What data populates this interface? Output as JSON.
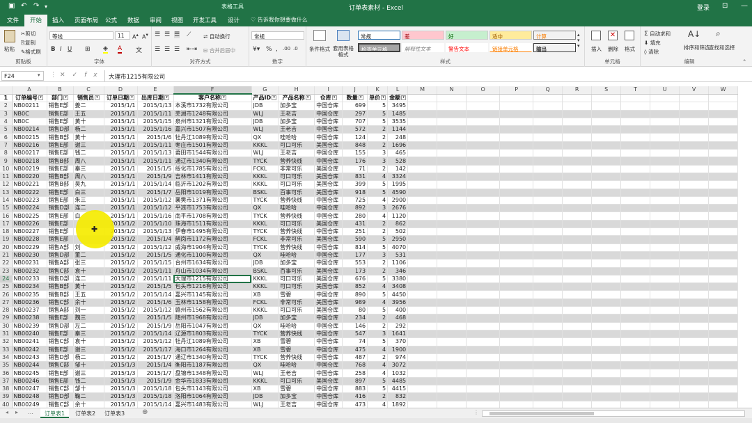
{
  "window": {
    "title": "订单表素材 - Excel",
    "tools_label": "表格工具",
    "login": "登录"
  },
  "tabs": [
    "文件",
    "开始",
    "插入",
    "页面布局",
    "公式",
    "数据",
    "审阅",
    "视图",
    "开发工具",
    "设计"
  ],
  "tell_me": "告诉我你想要做什么",
  "ribbon": {
    "clipboard": {
      "paste": "粘贴",
      "cut": "剪切",
      "copy": "复制",
      "painter": "格式刷",
      "label": "剪贴板"
    },
    "font": {
      "name": "等线",
      "size": "11",
      "label": "字体"
    },
    "alignment": {
      "wrap": "自动换行",
      "merge": "合并后居中",
      "label": "对齐方式"
    },
    "number": {
      "format": "常规",
      "label": "数字"
    },
    "styles": {
      "cond": "条件格式",
      "table": "套用表格格式",
      "cells": [
        "常规",
        "差",
        "好",
        "适中",
        "计算",
        "检查单元格",
        "解释性文本",
        "警告文本",
        "链接单元格",
        "输出"
      ],
      "label": "样式"
    },
    "cells": {
      "insert": "插入",
      "delete": "删除",
      "format": "格式",
      "label": "单元格"
    },
    "editing": {
      "autosum": "自动求和",
      "fill": "填充",
      "clear": "清除",
      "sort": "排序和筛选",
      "find": "查找和选择",
      "label": "编辑"
    }
  },
  "formula": {
    "name_box": "F24",
    "content": "大理市1215有限公司"
  },
  "columns": [
    "A",
    "B",
    "C",
    "D",
    "E",
    "F",
    "G",
    "H",
    "I",
    "J",
    "K",
    "L",
    "M",
    "N",
    "O",
    "P",
    "Q",
    "R",
    "S",
    "T",
    "U",
    "V",
    "W"
  ],
  "headers": [
    "订单编号",
    "部门",
    "销售员",
    "订单日期",
    "出库日期",
    "客户名称",
    "产品ID",
    "产品名称",
    "仓库",
    "数量",
    "单价",
    "金额"
  ],
  "rows": [
    [
      "NB00211",
      "销售E部",
      "姜二",
      "2015/1/1",
      "2015/1/13",
      "本溪市1732有限公司",
      "JDB",
      "加多宝",
      "中国仓库",
      "699",
      "5",
      "3495"
    ],
    [
      "NB0C",
      "销售E部",
      "王五",
      "2015/1/1",
      "2015/1/11",
      "芜湖市1248有限公司",
      "WLJ",
      "王老吉",
      "中国仓库",
      "297",
      "5",
      "1485"
    ],
    [
      "NB0C",
      "销售E部",
      "黄十",
      "2015/1/1",
      "2015/1/15",
      "泉州市1321有限公司",
      "JDB",
      "加多宝",
      "中国仓库",
      "707",
      "5",
      "3535"
    ],
    [
      "NB00214",
      "销售D部",
      "杨二",
      "2015/1/1",
      "2015/1/16",
      "嘉兴市1507有限公司",
      "WLJ",
      "王老吉",
      "中国仓库",
      "572",
      "2",
      "1144"
    ],
    [
      "NB00215",
      "销售B部",
      "黄十",
      "2015/1/1",
      "2015/1/6",
      "牡丹江1089有限公司",
      "QX",
      "哇哈哈",
      "中国仓库",
      "124",
      "2",
      "248"
    ],
    [
      "NB00216",
      "销售E部",
      "谢三",
      "2015/1/1",
      "2015/1/11",
      "枣庄市1501有限公司",
      "KKKL",
      "可口可乐",
      "美国仓库",
      "848",
      "2",
      "1696"
    ],
    [
      "NB00217",
      "销售E部",
      "钱二",
      "2015/1/1",
      "2015/1/13",
      "莆田市1544有限公司",
      "WLJ",
      "王老吉",
      "中国仓库",
      "155",
      "3",
      "465"
    ],
    [
      "NB00218",
      "销售B部",
      "周八",
      "2015/1/1",
      "2015/1/11",
      "通辽市1340有限公司",
      "TYCK",
      "营养快线",
      "中国仓库",
      "176",
      "3",
      "528"
    ],
    [
      "NB00219",
      "销售E部",
      "秦三",
      "2015/1/1",
      "2015/1/5",
      "绥化市1785有限公司",
      "FCKL",
      "非常可乐",
      "美国仓库",
      "71",
      "2",
      "142"
    ],
    [
      "NB00220",
      "销售B部",
      "周八",
      "2015/1/1",
      "2015/1/9",
      "吉林市1411有限公司",
      "KKKL",
      "可口可乐",
      "美国仓库",
      "831",
      "4",
      "3324"
    ],
    [
      "NB00221",
      "销售B部",
      "吴九",
      "2015/1/1",
      "2015/1/14",
      "临沂市1202有限公司",
      "KKKL",
      "可口可乐",
      "美国仓库",
      "399",
      "5",
      "1995"
    ],
    [
      "NB00222",
      "销售E部",
      "白三",
      "2015/1/1",
      "2015/1/7",
      "岳阳市1019有限公司",
      "BSKL",
      "百事可乐",
      "美国仓库",
      "918",
      "5",
      "4590"
    ],
    [
      "NB00223",
      "销售E部",
      "朱三",
      "2015/1/1",
      "2015/1/12",
      "襄樊市1371有限公司",
      "TYCK",
      "营养快线",
      "中国仓库",
      "725",
      "4",
      "2900"
    ],
    [
      "NB00224",
      "销售D部",
      "连二",
      "2015/1/1",
      "2015/1/12",
      "平凉市1753有限公司",
      "QX",
      "哇哈哈",
      "中国仓库",
      "892",
      "3",
      "2676"
    ],
    [
      "NB00225",
      "销售E部",
      "白",
      "2015/1/1",
      "2015/1/16",
      "南平市1708有限公司",
      "TYCK",
      "营养快线",
      "中国仓库",
      "280",
      "4",
      "1120"
    ],
    [
      "NB00226",
      "销售E部",
      "",
      "2015/1/2",
      "2015/1/10",
      "珠海市1511有限公司",
      "KKKL",
      "可口可乐",
      "美国仓库",
      "431",
      "2",
      "862"
    ],
    [
      "NB00227",
      "销售E部",
      "",
      "2015/1/2",
      "2015/1/13",
      "伊春市1495有限公司",
      "TYCK",
      "营养快线",
      "中国仓库",
      "251",
      "2",
      "502"
    ],
    [
      "NB00228",
      "销售E部",
      "",
      "2015/1/2",
      "2015/1/4",
      "鹤岗市1172有限公司",
      "FCKL",
      "非常可乐",
      "美国仓库",
      "590",
      "5",
      "2950"
    ],
    [
      "NB00229",
      "销售A部",
      "刘",
      "2015/1/2",
      "2015/1/12",
      "威海市1904有限公司",
      "TYCK",
      "营养快线",
      "中国仓库",
      "814",
      "5",
      "4070"
    ],
    [
      "NB00230",
      "销售D部",
      "董二",
      "2015/1/2",
      "2015/1/5",
      "通化市1100有限公司",
      "QX",
      "哇哈哈",
      "中国仓库",
      "177",
      "3",
      "531"
    ],
    [
      "NB00231",
      "销售A部",
      "张三",
      "2015/1/2",
      "2015/1/15",
      "台州市1634有限公司",
      "JDB",
      "加多宝",
      "中国仓库",
      "553",
      "2",
      "1106"
    ],
    [
      "NB00232",
      "销售C部",
      "袁十",
      "2015/1/2",
      "2015/1/11",
      "舟山市1034有限公司",
      "BSKL",
      "百事可乐",
      "美国仓库",
      "173",
      "2",
      "346"
    ],
    [
      "NB00233",
      "销售D部",
      "连二",
      "2015/1/2",
      "2015/1/11",
      "大理市1215有限公司",
      "KKKL",
      "可口可乐",
      "美国仓库",
      "676",
      "5",
      "3380"
    ],
    [
      "NB00234",
      "销售B部",
      "黄十",
      "2015/1/2",
      "2015/1/5",
      "包头市1216有限公司",
      "KKKL",
      "可口可乐",
      "美国仓库",
      "852",
      "4",
      "3408"
    ],
    [
      "NB00235",
      "销售B部",
      "王五",
      "2015/1/2",
      "2015/1/14",
      "嘉兴市1145有限公司",
      "XB",
      "雪碧",
      "中国仓库",
      "890",
      "5",
      "4450"
    ],
    [
      "NB00236",
      "销售C部",
      "余十",
      "2015/1/2",
      "2015/1/6",
      "玉林市1158有限公司",
      "FCKL",
      "非常可乐",
      "美国仓库",
      "989",
      "4",
      "3956"
    ],
    [
      "NB00237",
      "销售A部",
      "刘一",
      "2015/1/2",
      "2015/1/12",
      "赣州市1562有限公司",
      "KKKL",
      "可口可乐",
      "美国仓库",
      "80",
      "5",
      "400"
    ],
    [
      "NB00238",
      "销售E部",
      "魏三",
      "2015/1/2",
      "2015/1/5",
      "随州市1968有限公司",
      "JDB",
      "加多宝",
      "中国仓库",
      "234",
      "2",
      "468"
    ],
    [
      "NB00239",
      "销售D部",
      "左二",
      "2015/1/2",
      "2015/1/9",
      "岳阳市1047有限公司",
      "QX",
      "哇哈哈",
      "中国仓库",
      "146",
      "2",
      "292"
    ],
    [
      "NB00240",
      "销售E部",
      "秦三",
      "2015/1/2",
      "2015/1/14",
      "辽源市1803有限公司",
      "TYCK",
      "营养快线",
      "中国仓库",
      "547",
      "3",
      "1641"
    ],
    [
      "NB00241",
      "销售C部",
      "袁十",
      "2015/1/2",
      "2015/1/12",
      "牡丹江1089有限公司",
      "XB",
      "雪碧",
      "中国仓库",
      "74",
      "5",
      "370"
    ],
    [
      "NB00242",
      "销售E部",
      "谢三",
      "2015/1/2",
      "2015/1/17",
      "海口市1264有限公司",
      "XB",
      "雪碧",
      "中国仓库",
      "475",
      "4",
      "1900"
    ],
    [
      "NB00243",
      "销售D部",
      "杨二",
      "2015/1/2",
      "2015/1/7",
      "通辽市1340有限公司",
      "TYCK",
      "营养快线",
      "中国仓库",
      "487",
      "2",
      "974"
    ],
    [
      "NB00244",
      "销售C部",
      "邹十",
      "2015/1/3",
      "2015/1/4",
      "衡阳市1187有限公司",
      "QX",
      "哇哈哈",
      "中国仓库",
      "768",
      "4",
      "3072"
    ],
    [
      "NB00245",
      "销售E部",
      "谢三",
      "2015/1/3",
      "2015/1/7",
      "盘锦市1348有限公司",
      "WLJ",
      "王老吉",
      "中国仓库",
      "258",
      "4",
      "1032"
    ],
    [
      "NB00246",
      "销售E部",
      "钱二",
      "2015/1/3",
      "2015/1/9",
      "金华市1833有限公司",
      "KKKL",
      "可口可乐",
      "美国仓库",
      "897",
      "5",
      "4485"
    ],
    [
      "NB00247",
      "销售C部",
      "邹十",
      "2015/1/3",
      "2015/1/18",
      "包头市1143有限公司",
      "XB",
      "雪碧",
      "中国仓库",
      "883",
      "5",
      "4415"
    ],
    [
      "NB00248",
      "销售D部",
      "鞠二",
      "2015/1/3",
      "2015/1/18",
      "洛阳市1064有限公司",
      "JDB",
      "加多宝",
      "中国仓库",
      "416",
      "2",
      "832"
    ],
    [
      "NB00249",
      "销售C部",
      "余十",
      "2015/1/3",
      "2015/1/14",
      "嘉兴市1483有限公司",
      "WLJ",
      "王老吉",
      "中国仓库",
      "473",
      "4",
      "1892"
    ]
  ],
  "selected": {
    "row": 24,
    "col": "F"
  },
  "sheets": [
    "订单表1",
    "订单表2",
    "订单表3"
  ],
  "colors": {
    "brand": "#217346",
    "bad": "#ffc7ce",
    "good": "#c6efce",
    "neutral": "#ffeb9c",
    "calc": "#f2f2f2",
    "check": "#a5a5a5",
    "highlight": "#f5ec00"
  }
}
